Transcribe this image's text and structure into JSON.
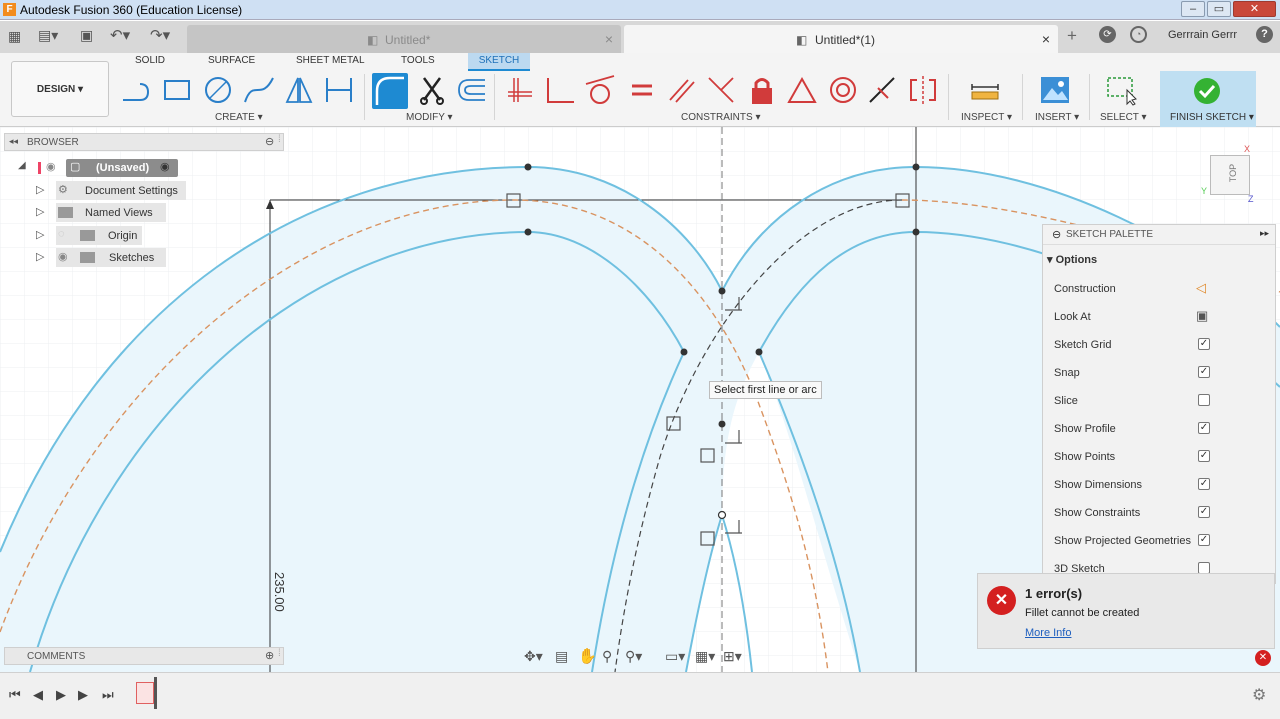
{
  "window": {
    "title": "Autodesk Fusion 360 (Education License)",
    "app_icon": "F"
  },
  "tabs": [
    {
      "label": "Untitled*",
      "active": false
    },
    {
      "label": "Untitled*(1)",
      "active": true
    }
  ],
  "user": {
    "name": "Gerrrain Gerrr"
  },
  "toolbar": {
    "design_label": "DESIGN",
    "workspace_tabs": [
      "SOLID",
      "SURFACE",
      "SHEET METAL",
      "TOOLS",
      "SKETCH"
    ],
    "active_workspace": "SKETCH",
    "groups": {
      "create": "CREATE",
      "modify": "MODIFY",
      "constraints": "CONSTRAINTS",
      "inspect": "INSPECT",
      "insert": "INSERT",
      "select": "SELECT",
      "finish": "FINISH SKETCH"
    }
  },
  "browser": {
    "title": "BROWSER",
    "root": "(Unsaved)",
    "items": [
      {
        "label": "Document Settings",
        "icon": "gear-icon"
      },
      {
        "label": "Named Views",
        "icon": "folder-icon"
      },
      {
        "label": "Origin",
        "icon": "folder-icon"
      },
      {
        "label": "Sketches",
        "icon": "folder-icon"
      }
    ]
  },
  "comments": {
    "title": "COMMENTS"
  },
  "canvas": {
    "tooltip": "Select first line or arc",
    "dimension": "235.00",
    "viewcube": "TOP"
  },
  "palette": {
    "title": "SKETCH PALETTE",
    "section": "Options",
    "rows": [
      {
        "label": "Construction",
        "type": "icon",
        "icon": "construction-icon"
      },
      {
        "label": "Look At",
        "type": "icon",
        "icon": "look-at-icon"
      },
      {
        "label": "Sketch Grid",
        "type": "check",
        "checked": true
      },
      {
        "label": "Snap",
        "type": "check",
        "checked": true
      },
      {
        "label": "Slice",
        "type": "check",
        "checked": false
      },
      {
        "label": "Show Profile",
        "type": "check",
        "checked": true
      },
      {
        "label": "Show Points",
        "type": "check",
        "checked": true
      },
      {
        "label": "Show Dimensions",
        "type": "check",
        "checked": true
      },
      {
        "label": "Show Constraints",
        "type": "check",
        "checked": true
      },
      {
        "label": "Show Projected Geometries",
        "type": "check",
        "checked": true
      },
      {
        "label": "3D Sketch",
        "type": "check",
        "checked": false
      }
    ]
  },
  "error": {
    "title": "1 error(s)",
    "message": "Fillet cannot be created",
    "link": "More Info"
  },
  "colors": {
    "accent": "#1e8ad2",
    "sketch_line": "#6fc0e0",
    "error": "#d42020",
    "constraint_red": "#d13b3b"
  }
}
